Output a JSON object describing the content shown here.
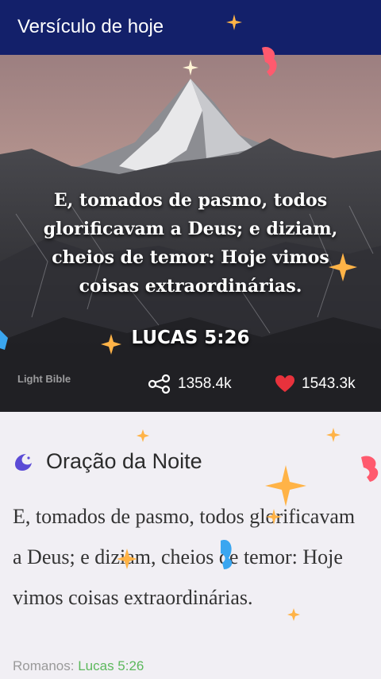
{
  "app_bar": {
    "title": "Versículo de hoje"
  },
  "hero": {
    "verse_text": "E, tomados de pasmo, todos glorificavam a Deus; e diziam, cheios de temor: Hoje vimos coisas extraordinárias.",
    "reference": "LUCAS 5:26",
    "brand": "Light Bible",
    "share_count": "1358.4k",
    "like_count": "1543.3k"
  },
  "prayer_card": {
    "title": "Oração da Noite",
    "body": "E, tomados de pasmo, todos glorificavam a Deus; e diziam, cheios de temor: Hoje vimos coisas extraordinárias.",
    "source_label": "Romanos: ",
    "source_link": "Lucas 5:26"
  },
  "colors": {
    "app_bar": "#13206a",
    "heart": "#e8323c",
    "link": "#5cb85c",
    "moon": "#5b4bd6"
  },
  "icons": [
    "share-icon",
    "heart-icon",
    "moon-icon"
  ]
}
